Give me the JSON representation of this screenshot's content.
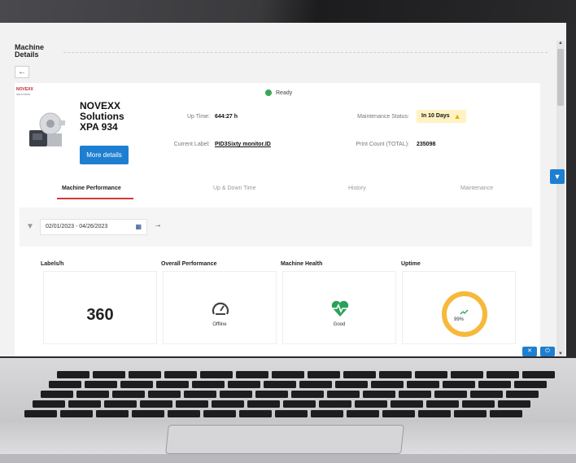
{
  "page": {
    "title": "Machine Details",
    "back_label": "←"
  },
  "brand": {
    "name": "NOVEXX",
    "sub": "SOLUTIONS"
  },
  "machine": {
    "status": "Ready",
    "name": "NOVEXX Solutions XPA 934",
    "more_details_label": "More details",
    "up_time_label": "Up Time:",
    "up_time_value": "644:27 h",
    "current_label_label": "Current Label:",
    "current_label_value": "PID3Sixty monitor.ID",
    "maintenance_status_label": "Maintenance Status:",
    "maintenance_status_value": "In 10 Days",
    "print_count_label": "Print Count (TOTAL):",
    "print_count_value": "235098"
  },
  "tabs": [
    {
      "label": "Machine Performance",
      "active": true
    },
    {
      "label": "Up & Down Time",
      "active": false
    },
    {
      "label": "History",
      "active": false
    },
    {
      "label": "Maintenance",
      "active": false
    }
  ],
  "filter": {
    "date_range": "02/01/2023 - 04/26/2023",
    "next_label": "→"
  },
  "metrics": {
    "labels_per_hour": {
      "title": "Labels/h",
      "value": "360"
    },
    "overall_performance": {
      "title": "Overall Performance",
      "status": "Offline"
    },
    "machine_health": {
      "title": "Machine Health",
      "status": "Good"
    },
    "uptime": {
      "title": "Uptime",
      "value": "99%",
      "fraction": 0.99
    }
  },
  "colors": {
    "accent": "#1e7fd0",
    "status_ready": "#3aa655",
    "tab_underline": "#d23a3a",
    "maintenance_badge": "#fff3c4",
    "warning": "#f2a900",
    "health": "#2aa15a",
    "uptime_ring": "#f6b93b"
  },
  "icons": {
    "back": "arrow-left-icon",
    "status": "status-dot-icon",
    "warning": "warning-triangle-icon",
    "filter": "funnel-icon",
    "calendar": "calendar-icon",
    "gauge": "speedometer-icon",
    "health": "heartbeat-icon",
    "trend": "trend-up-icon"
  }
}
